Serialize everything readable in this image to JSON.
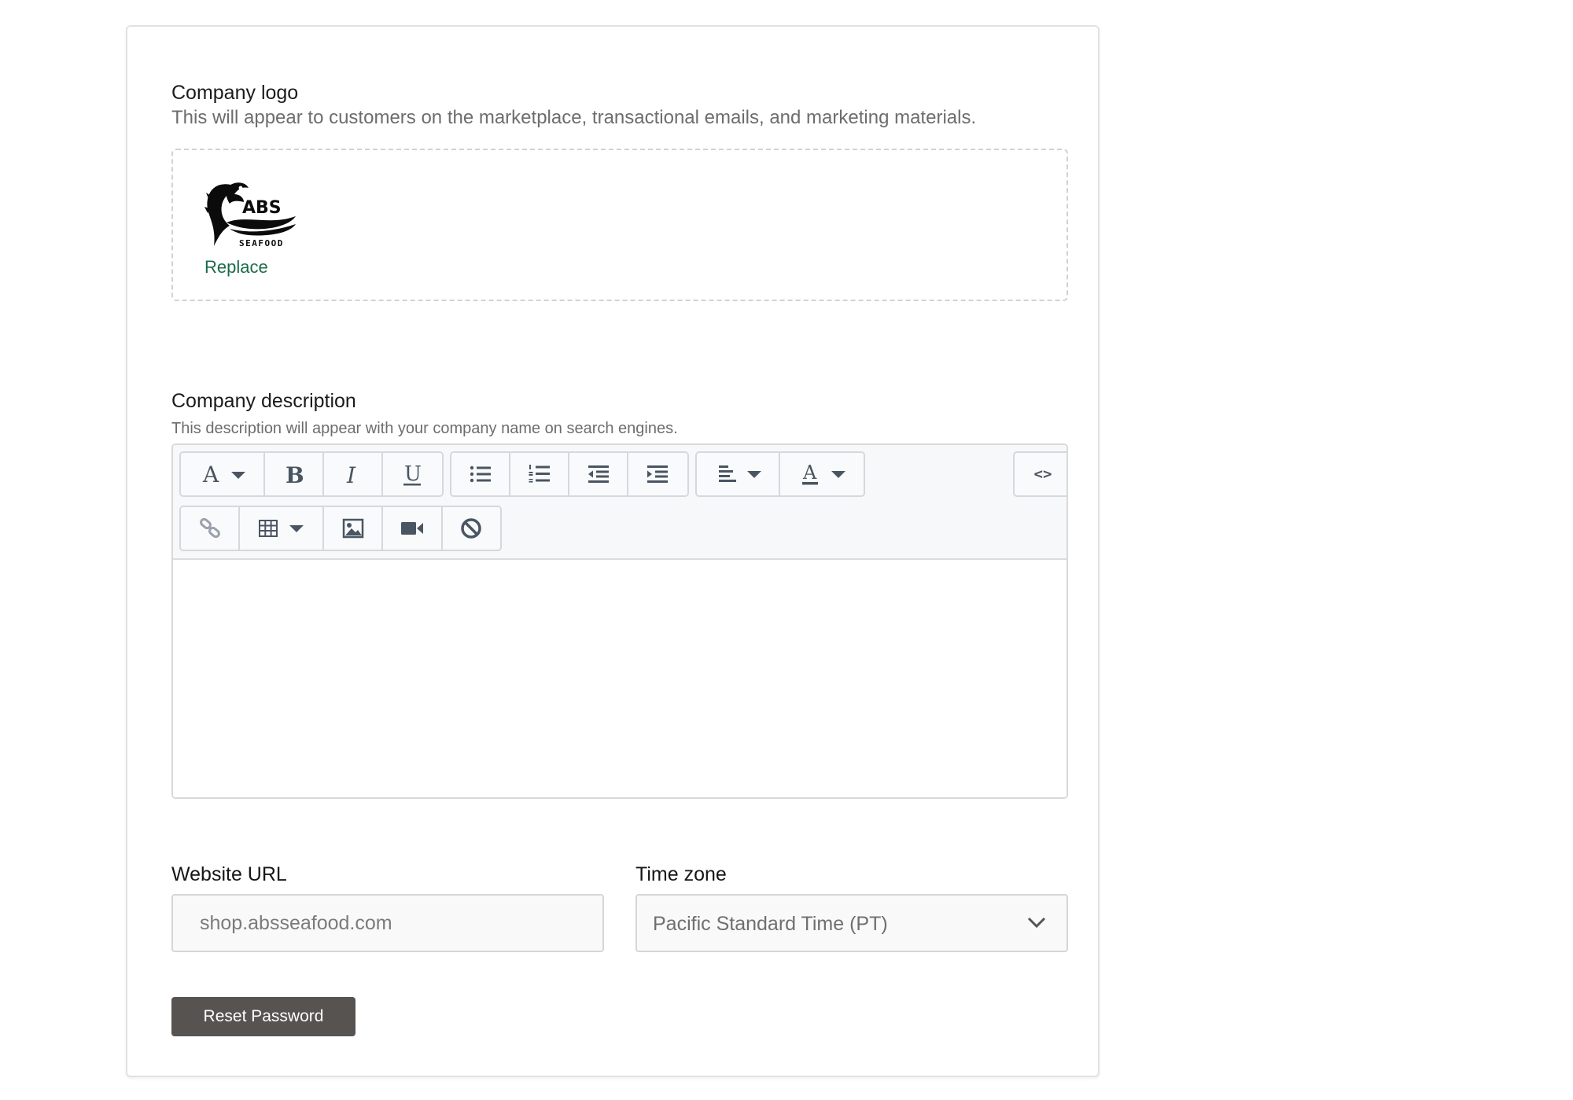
{
  "logo_section": {
    "title": "Company logo",
    "description": "This will appear to customers on the marketplace, transactional emails, and marketing materials.",
    "logo_text": "ABS",
    "logo_subtext": "SEAFOOD",
    "replace_label": "Replace"
  },
  "description_section": {
    "title": "Company description",
    "description": "This description will appear with your company name on search engines.",
    "editor_value": "",
    "toolbar": {
      "code_view_label": "<>"
    }
  },
  "website": {
    "label": "Website URL",
    "placeholder": "shop.absseafood.com",
    "value": ""
  },
  "timezone": {
    "label": "Time zone",
    "selected": "Pacific Standard Time (PT)"
  },
  "actions": {
    "reset_password_label": "Reset Password"
  },
  "colors": {
    "accent_link": "#1a6b48",
    "button_bg": "#575350"
  }
}
